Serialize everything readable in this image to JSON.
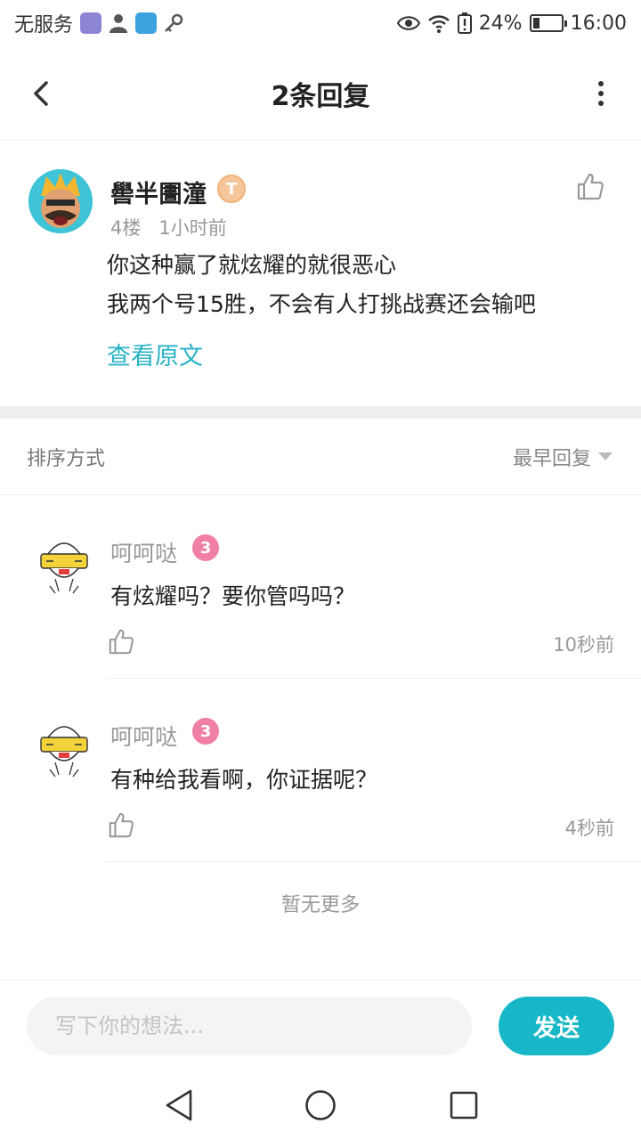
{
  "status_bar": {
    "carrier": "无服务",
    "battery": "24%",
    "battery_level": 0.24,
    "time": "16:00",
    "icons": [
      "app-icon-purple",
      "person-icon",
      "app-icon-blue",
      "key-icon",
      "eye-icon",
      "wifi-icon",
      "battery-alert-icon",
      "battery-icon"
    ]
  },
  "header": {
    "title": "2条回复",
    "icons": [
      "back-arrow-icon",
      "more-vertical-icon"
    ]
  },
  "post": {
    "author": "嚳半圕潼",
    "badge": "T",
    "floor": "4楼",
    "time": "1小时前",
    "lines": [
      "你这种赢了就炫耀的就很恶心",
      "我两个号15胜，不会有人打挑战赛还会输吧"
    ],
    "view_original": "查看原文",
    "icons": [
      "avatar-icon",
      "thumb-up-icon"
    ]
  },
  "sort": {
    "label": "排序方式",
    "selected": "最早回复"
  },
  "replies": [
    {
      "author": "呵呵哒",
      "level": "3",
      "text": "有炫耀吗？要你管吗吗？",
      "time": "10秒前"
    },
    {
      "author": "呵呵哒",
      "level": "3",
      "text": "有种给我看啊，你证据呢？",
      "time": "4秒前"
    }
  ],
  "footer": {
    "no_more": "暂无更多",
    "input_placeholder": "写下你的想法...",
    "send_label": "发送"
  },
  "colors": {
    "accent": "#17b7c7",
    "link": "#29b3c6",
    "level_badge": "#f07fa6",
    "title_badge": "#f6c79a"
  }
}
